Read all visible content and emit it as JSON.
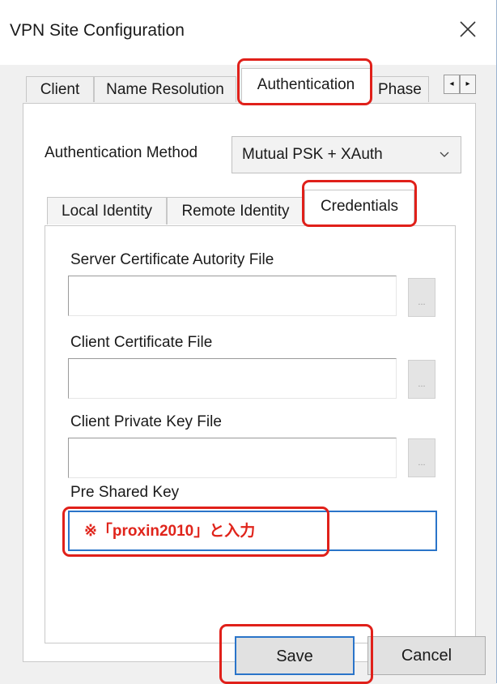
{
  "window": {
    "title": "VPN Site Configuration"
  },
  "tabs": [
    {
      "label": "Client"
    },
    {
      "label": "Name Resolution"
    },
    {
      "label": "Authentication"
    },
    {
      "label": "Phase"
    }
  ],
  "tab_scroll": {
    "left": "◂",
    "right": "▸"
  },
  "authentication": {
    "method_label": "Authentication Method",
    "method_value": "Mutual PSK + XAuth",
    "subtabs": [
      {
        "label": "Local Identity"
      },
      {
        "label": "Remote Identity"
      },
      {
        "label": "Credentials"
      }
    ]
  },
  "credentials": {
    "server_ca_label": "Server Certificate Autority File",
    "server_ca_value": "",
    "client_cert_label": "Client Certificate File",
    "client_cert_value": "",
    "client_key_label": "Client Private Key File",
    "client_key_value": "",
    "browse_label": "...",
    "psk_label": "Pre Shared Key",
    "psk_value": "",
    "psk_note": "※「proxin2010」と入力"
  },
  "buttons": {
    "save": "Save",
    "cancel": "Cancel"
  },
  "colors": {
    "highlight": "#e0201a",
    "focus": "#2a74c9",
    "note": "#e0241b"
  }
}
